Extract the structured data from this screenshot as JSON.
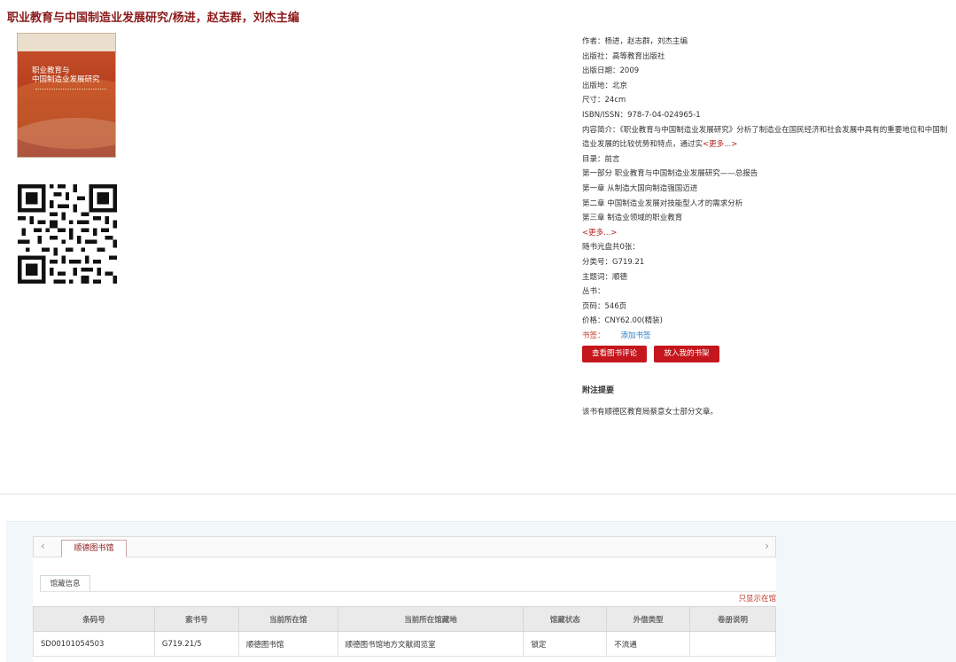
{
  "book": {
    "title": "职业教育与中国制造业发展研究/杨进，赵志群，刘杰主编",
    "cover_title_line1": "职业教育与",
    "cover_title_line2": "中国制造业发展研究"
  },
  "meta": {
    "author": "作者：杨进，赵志群，刘杰主编",
    "publisher": "出版社：高等教育出版社",
    "pub_date": "出版日期：2009",
    "pub_place": "出版地：北京",
    "size": "尺寸：24cm",
    "isbn": "ISBN/ISSN：978-7-04-024965-1",
    "summary": "内容简介：《职业教育与中国制造业发展研究》分析了制造业在国民经济和社会发展中具有的重要地位和中国制造业发展的比较优势和特点，通过实",
    "summary_more": "<更多...>",
    "toc_label": "目录：前言",
    "toc_items": [
      "第一部分 职业教育与中国制造业发展研究——总报告",
      "第一章 从制造大国向制造强国迈进",
      "第二章 中国制造业发展对技能型人才的需求分析",
      "第三章 制造业领域的职业教育"
    ],
    "toc_more": "<更多...>",
    "cd": "随书光盘共0张：",
    "class_no": "分类号：G719.21",
    "subject": "主题词：顺德",
    "series": "丛书：",
    "pages": "页码：546页",
    "price": "价格：CNY62.00(精装)",
    "tags_label": "书签：",
    "add_tag": "添加书签"
  },
  "buttons": {
    "review": "查看图书评论",
    "shelf": "放入我的书架"
  },
  "note": {
    "heading": "附注提要",
    "body": "该书有顺德区教育局蔡意女士部分文章。"
  },
  "holdings": {
    "library_tab": "顺德图书馆",
    "info_tab": "馆藏信息",
    "only_show": "只显示在馆",
    "columns": [
      "条码号",
      "索书号",
      "当前所在馆",
      "当前所在馆藏地",
      "馆藏状态",
      "外借类型",
      "卷册说明"
    ],
    "rows": [
      [
        "SD00101054503",
        "G719.21/5",
        "顺德图书馆",
        "顺德图书馆地方文献阅览室",
        "锁定",
        "不流通",
        ""
      ]
    ]
  }
}
